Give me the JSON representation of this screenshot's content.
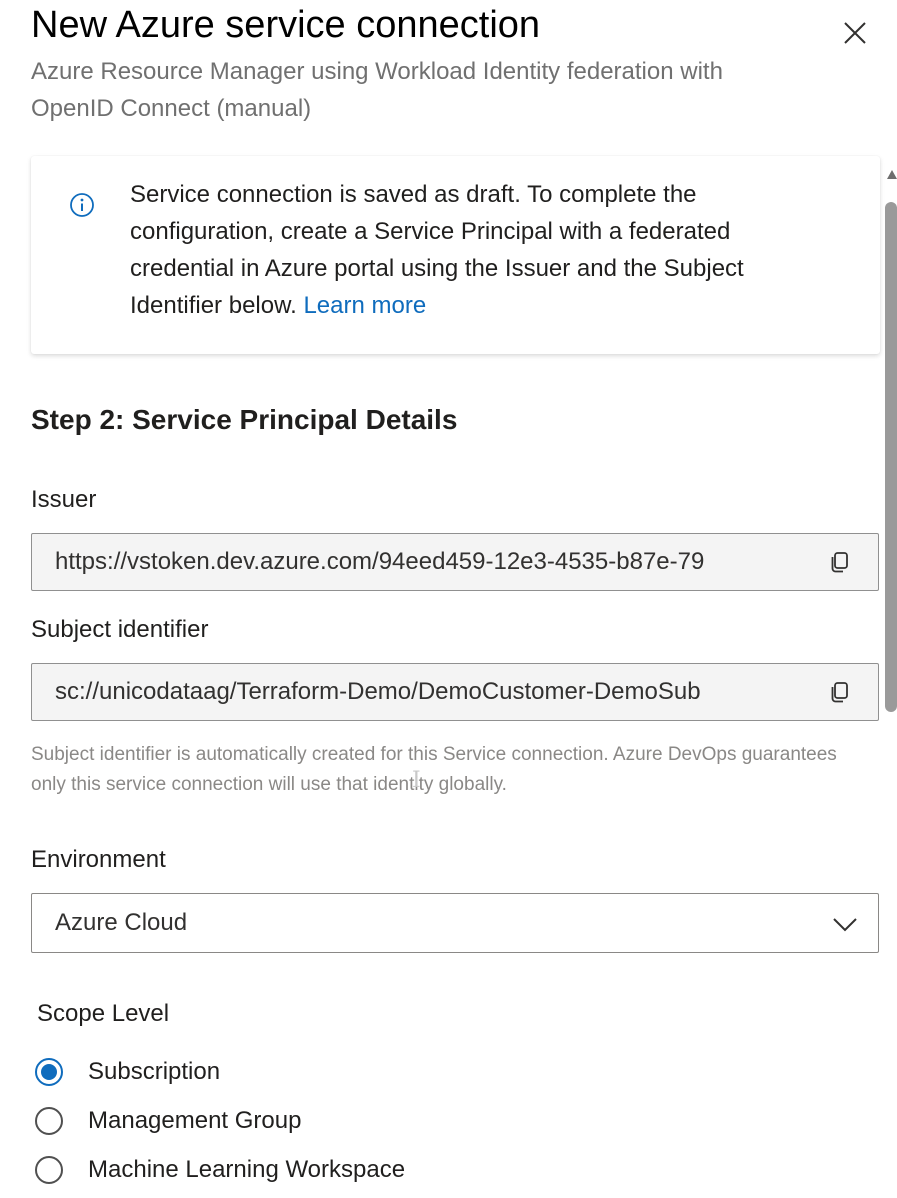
{
  "dialog": {
    "title": "New Azure service connection",
    "subtitle": "Azure Resource Manager using Workload Identity federation with OpenID Connect (manual)",
    "close_icon": "close-icon"
  },
  "info_banner": {
    "icon": "info-icon",
    "text": "Service connection is saved as draft. To complete the configuration, create a Service Principal with a federated credential in Azure portal using the Issuer and the Subject Identifier below.",
    "link_label": "Learn more"
  },
  "step": {
    "heading": "Step 2: Service Principal Details"
  },
  "issuer": {
    "label": "Issuer",
    "value": "https://vstoken.dev.azure.com/94eed459-12e3-4535-b87e-79",
    "copy_icon": "copy-icon"
  },
  "subject_identifier": {
    "label": "Subject identifier",
    "value": "sc://unicodataag/Terraform-Demo/DemoCustomer-DemoSub",
    "copy_icon": "copy-icon",
    "helper_text": "Subject identifier is automatically created for this Service connection. Azure DevOps guarantees only this service connection will use that identity globally."
  },
  "environment": {
    "label": "Environment",
    "selected": "Azure Cloud",
    "chevron_icon": "chevron-down-icon"
  },
  "scope_level": {
    "label": "Scope Level",
    "options": [
      {
        "label": "Subscription",
        "checked": true
      },
      {
        "label": "Management Group",
        "checked": false
      },
      {
        "label": "Machine Learning Workspace",
        "checked": false
      }
    ]
  },
  "colors": {
    "accent": "#0f6cbd",
    "muted_text": "#707070",
    "field_bg": "#f4f4f4"
  }
}
